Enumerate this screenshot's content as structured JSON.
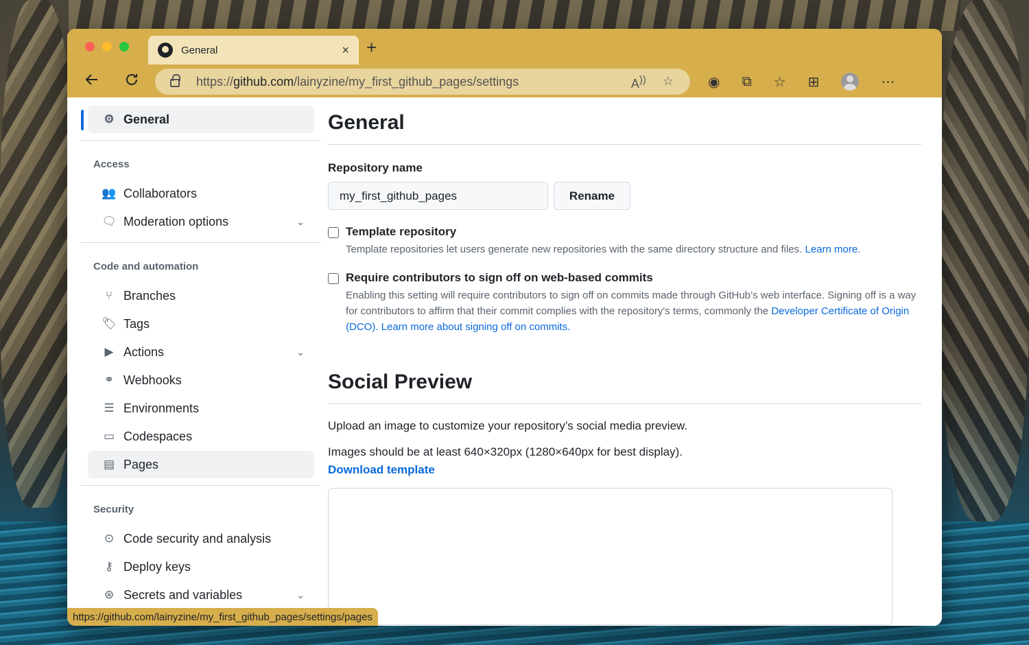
{
  "browser": {
    "tab_title": "General",
    "tab_close": "×",
    "new_tab": "+",
    "url_prefix": "https://",
    "url_host": "github.com",
    "url_path": "/lainyzine/my_first_github_pages/settings",
    "status_url": "https://github.com/lainyzine/my_first_github_pages/settings/pages"
  },
  "sidebar": {
    "general": "General",
    "access_heading": "Access",
    "collaborators": "Collaborators",
    "moderation": "Moderation options",
    "code_heading": "Code and automation",
    "branches": "Branches",
    "tags": "Tags",
    "actions": "Actions",
    "webhooks": "Webhooks",
    "environments": "Environments",
    "codespaces": "Codespaces",
    "pages": "Pages",
    "security_heading": "Security",
    "code_security": "Code security and analysis",
    "deploy_keys": "Deploy keys",
    "secrets": "Secrets and variables"
  },
  "main": {
    "title": "General",
    "repo_name_label": "Repository name",
    "repo_name_value": "my_first_github_pages",
    "rename_button": "Rename",
    "template_title": "Template repository",
    "template_desc": "Template repositories let users generate new repositories with the same directory structure and files.",
    "template_link": "Learn more.",
    "signoff_title": "Require contributors to sign off on web-based commits",
    "signoff_desc": "Enabling this setting will require contributors to sign off on commits made through GitHub’s web interface. Signing off is a way for contributors to affirm that their commit complies with the repository's terms, commonly the",
    "signoff_link1": "Developer Certificate of Origin (DCO).",
    "signoff_link2": "Learn more about signing off on commits",
    "signoff_period": ".",
    "social_title": "Social Preview",
    "social_p1": "Upload an image to customize your repository’s social media preview.",
    "social_p2": "Images should be at least 640×320px (1280×640px for best display).",
    "download_link": "Download template"
  },
  "icons": {
    "back": "back-arrow-icon",
    "reload": "reload-icon",
    "lock": "lock-icon",
    "gear": "gear-icon"
  },
  "colors": {
    "accent_blue": "#0969da",
    "browser_chrome": "#d7ae4c"
  }
}
